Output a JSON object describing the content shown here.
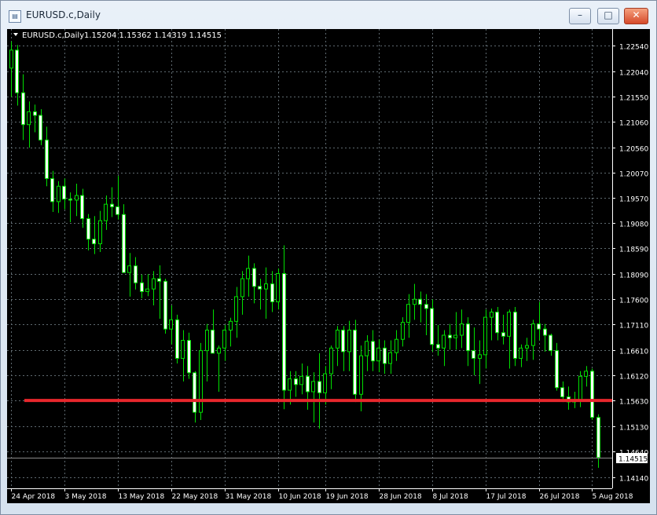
{
  "window": {
    "title": "EURUSD.c,Daily",
    "controls": {
      "minimize": "–",
      "maximize": "□",
      "close": "✕"
    }
  },
  "chart_header": {
    "symbol": "EURUSD.c,Daily",
    "ohlc": "1.15204 1.15362 1.14319 1.14515"
  },
  "chart_data": {
    "type": "candlestick",
    "symbol": "EURUSD.c",
    "timeframe": "Daily",
    "price_axis": {
      "range": [
        1.1392,
        1.2286
      ],
      "ticks": [
        1.2254,
        1.2204,
        1.2155,
        1.2106,
        1.2056,
        1.2007,
        1.1957,
        1.1908,
        1.1859,
        1.1809,
        1.176,
        1.1711,
        1.1661,
        1.1612,
        1.1563,
        1.1513,
        1.1464,
        1.1414
      ],
      "tick_labels": [
        "1.22540",
        "1.22040",
        "1.21550",
        "1.21060",
        "1.20560",
        "1.20070",
        "1.19570",
        "1.19080",
        "1.18590",
        "1.18090",
        "1.17600",
        "1.17110",
        "1.16610",
        "1.16120",
        "1.15630",
        "1.15130",
        "1.14640",
        "1.14140"
      ],
      "current_price": 1.14515,
      "current_price_label": "1.14515"
    },
    "time_axis": {
      "labels": [
        "24 Apr 2018",
        "3 May 2018",
        "13 May 2018",
        "22 May 2018",
        "31 May 2018",
        "10 Jun 2018",
        "19 Jun 2018",
        "28 Jun 2018",
        "8 Jul 2018",
        "17 Jul 2018",
        "26 Jul 2018",
        "5 Aug 2018"
      ]
    },
    "horizontal_line": {
      "price": 1.1563,
      "color": "#e8272c"
    },
    "colors": {
      "background": "#000000",
      "bull_body": "#000000",
      "bear_body": "#ffffff",
      "wick": "#00e000",
      "grid": "#5f6a70",
      "text": "#ffffff"
    },
    "grid": true,
    "candles": [
      {
        "o": 1.221,
        "h": 1.2262,
        "l": 1.2154,
        "c": 1.2245
      },
      {
        "o": 1.2245,
        "h": 1.2255,
        "l": 1.2137,
        "c": 1.2162
      },
      {
        "o": 1.2162,
        "h": 1.2198,
        "l": 1.207,
        "c": 1.21
      },
      {
        "o": 1.21,
        "h": 1.2145,
        "l": 1.2055,
        "c": 1.2125
      },
      {
        "o": 1.2125,
        "h": 1.2139,
        "l": 1.2085,
        "c": 1.2118
      },
      {
        "o": 1.2118,
        "h": 1.213,
        "l": 1.206,
        "c": 1.207
      },
      {
        "o": 1.207,
        "h": 1.2096,
        "l": 1.198,
        "c": 1.1995
      },
      {
        "o": 1.1995,
        "h": 1.201,
        "l": 1.193,
        "c": 1.195
      },
      {
        "o": 1.195,
        "h": 1.199,
        "l": 1.1928,
        "c": 1.198
      },
      {
        "o": 1.198,
        "h": 1.1995,
        "l": 1.1935,
        "c": 1.1955
      },
      {
        "o": 1.1955,
        "h": 1.1968,
        "l": 1.191,
        "c": 1.1953
      },
      {
        "o": 1.1953,
        "h": 1.1985,
        "l": 1.1922,
        "c": 1.1962
      },
      {
        "o": 1.1962,
        "h": 1.1975,
        "l": 1.1899,
        "c": 1.1917
      },
      {
        "o": 1.1917,
        "h": 1.1926,
        "l": 1.1855,
        "c": 1.1877
      },
      {
        "o": 1.1877,
        "h": 1.1922,
        "l": 1.1848,
        "c": 1.1868
      },
      {
        "o": 1.1868,
        "h": 1.1932,
        "l": 1.1852,
        "c": 1.1913
      },
      {
        "o": 1.1913,
        "h": 1.1962,
        "l": 1.1895,
        "c": 1.1945
      },
      {
        "o": 1.1945,
        "h": 1.1978,
        "l": 1.192,
        "c": 1.194
      },
      {
        "o": 1.194,
        "h": 1.2,
        "l": 1.1915,
        "c": 1.1925
      },
      {
        "o": 1.1925,
        "h": 1.1945,
        "l": 1.183,
        "c": 1.1812
      },
      {
        "o": 1.1812,
        "h": 1.185,
        "l": 1.1765,
        "c": 1.1825
      },
      {
        "o": 1.1825,
        "h": 1.1842,
        "l": 1.1779,
        "c": 1.1792
      },
      {
        "o": 1.1792,
        "h": 1.1808,
        "l": 1.1762,
        "c": 1.1775
      },
      {
        "o": 1.1775,
        "h": 1.1809,
        "l": 1.1766,
        "c": 1.178
      },
      {
        "o": 1.178,
        "h": 1.1815,
        "l": 1.1748,
        "c": 1.18
      },
      {
        "o": 1.18,
        "h": 1.1826,
        "l": 1.1722,
        "c": 1.1795
      },
      {
        "o": 1.1795,
        "h": 1.18,
        "l": 1.1693,
        "c": 1.1702
      },
      {
        "o": 1.1702,
        "h": 1.1748,
        "l": 1.1672,
        "c": 1.172
      },
      {
        "o": 1.172,
        "h": 1.173,
        "l": 1.1635,
        "c": 1.1645
      },
      {
        "o": 1.1645,
        "h": 1.17,
        "l": 1.16,
        "c": 1.168
      },
      {
        "o": 1.168,
        "h": 1.1695,
        "l": 1.1605,
        "c": 1.1617
      },
      {
        "o": 1.1617,
        "h": 1.162,
        "l": 1.152,
        "c": 1.154
      },
      {
        "o": 1.154,
        "h": 1.1675,
        "l": 1.1525,
        "c": 1.166
      },
      {
        "o": 1.166,
        "h": 1.1712,
        "l": 1.16,
        "c": 1.17
      },
      {
        "o": 1.17,
        "h": 1.174,
        "l": 1.1665,
        "c": 1.1655
      },
      {
        "o": 1.1655,
        "h": 1.167,
        "l": 1.158,
        "c": 1.1665
      },
      {
        "o": 1.1665,
        "h": 1.171,
        "l": 1.164,
        "c": 1.17
      },
      {
        "o": 1.17,
        "h": 1.1724,
        "l": 1.1668,
        "c": 1.1717
      },
      {
        "o": 1.1717,
        "h": 1.1784,
        "l": 1.1685,
        "c": 1.1765
      },
      {
        "o": 1.1765,
        "h": 1.1815,
        "l": 1.173,
        "c": 1.18
      },
      {
        "o": 1.18,
        "h": 1.1845,
        "l": 1.1765,
        "c": 1.182
      },
      {
        "o": 1.182,
        "h": 1.183,
        "l": 1.1752,
        "c": 1.1785
      },
      {
        "o": 1.1785,
        "h": 1.18,
        "l": 1.174,
        "c": 1.178
      },
      {
        "o": 1.178,
        "h": 1.1822,
        "l": 1.1722,
        "c": 1.179
      },
      {
        "o": 1.179,
        "h": 1.1815,
        "l": 1.1735,
        "c": 1.1755
      },
      {
        "o": 1.1755,
        "h": 1.182,
        "l": 1.174,
        "c": 1.181
      },
      {
        "o": 1.181,
        "h": 1.1865,
        "l": 1.1546,
        "c": 1.1583
      },
      {
        "o": 1.1583,
        "h": 1.162,
        "l": 1.1555,
        "c": 1.1605
      },
      {
        "o": 1.1605,
        "h": 1.162,
        "l": 1.157,
        "c": 1.1594
      },
      {
        "o": 1.1594,
        "h": 1.1635,
        "l": 1.1575,
        "c": 1.161
      },
      {
        "o": 1.161,
        "h": 1.163,
        "l": 1.1545,
        "c": 1.158
      },
      {
        "o": 1.158,
        "h": 1.1618,
        "l": 1.152,
        "c": 1.16
      },
      {
        "o": 1.16,
        "h": 1.1655,
        "l": 1.1508,
        "c": 1.1578
      },
      {
        "o": 1.1578,
        "h": 1.163,
        "l": 1.1555,
        "c": 1.1615
      },
      {
        "o": 1.1615,
        "h": 1.167,
        "l": 1.1585,
        "c": 1.1665
      },
      {
        "o": 1.1665,
        "h": 1.1708,
        "l": 1.163,
        "c": 1.17
      },
      {
        "o": 1.17,
        "h": 1.1708,
        "l": 1.162,
        "c": 1.1658
      },
      {
        "o": 1.1658,
        "h": 1.1718,
        "l": 1.162,
        "c": 1.17
      },
      {
        "o": 1.17,
        "h": 1.172,
        "l": 1.156,
        "c": 1.1575
      },
      {
        "o": 1.1575,
        "h": 1.167,
        "l": 1.1542,
        "c": 1.165
      },
      {
        "o": 1.165,
        "h": 1.169,
        "l": 1.162,
        "c": 1.1678
      },
      {
        "o": 1.1678,
        "h": 1.17,
        "l": 1.162,
        "c": 1.164
      },
      {
        "o": 1.164,
        "h": 1.1682,
        "l": 1.1618,
        "c": 1.1665
      },
      {
        "o": 1.1665,
        "h": 1.168,
        "l": 1.1615,
        "c": 1.1635
      },
      {
        "o": 1.1635,
        "h": 1.168,
        "l": 1.1615,
        "c": 1.1656
      },
      {
        "o": 1.1656,
        "h": 1.17,
        "l": 1.164,
        "c": 1.1682
      },
      {
        "o": 1.1682,
        "h": 1.1725,
        "l": 1.1668,
        "c": 1.1715
      },
      {
        "o": 1.1715,
        "h": 1.177,
        "l": 1.1685,
        "c": 1.175
      },
      {
        "o": 1.175,
        "h": 1.179,
        "l": 1.172,
        "c": 1.176
      },
      {
        "o": 1.176,
        "h": 1.1775,
        "l": 1.1715,
        "c": 1.175
      },
      {
        "o": 1.175,
        "h": 1.177,
        "l": 1.169,
        "c": 1.1742
      },
      {
        "o": 1.1742,
        "h": 1.176,
        "l": 1.1658,
        "c": 1.1672
      },
      {
        "o": 1.1672,
        "h": 1.171,
        "l": 1.165,
        "c": 1.1665
      },
      {
        "o": 1.1665,
        "h": 1.17,
        "l": 1.163,
        "c": 1.169
      },
      {
        "o": 1.169,
        "h": 1.1712,
        "l": 1.1662,
        "c": 1.1685
      },
      {
        "o": 1.1685,
        "h": 1.1735,
        "l": 1.1662,
        "c": 1.169
      },
      {
        "o": 1.169,
        "h": 1.174,
        "l": 1.1665,
        "c": 1.1712
      },
      {
        "o": 1.1712,
        "h": 1.1725,
        "l": 1.163,
        "c": 1.166
      },
      {
        "o": 1.166,
        "h": 1.1705,
        "l": 1.1612,
        "c": 1.1645
      },
      {
        "o": 1.1645,
        "h": 1.168,
        "l": 1.1595,
        "c": 1.1652
      },
      {
        "o": 1.1652,
        "h": 1.174,
        "l": 1.1625,
        "c": 1.1725
      },
      {
        "o": 1.1725,
        "h": 1.1742,
        "l": 1.168,
        "c": 1.1735
      },
      {
        "o": 1.1735,
        "h": 1.1745,
        "l": 1.168,
        "c": 1.1695
      },
      {
        "o": 1.1695,
        "h": 1.173,
        "l": 1.1672,
        "c": 1.1688
      },
      {
        "o": 1.1688,
        "h": 1.174,
        "l": 1.1625,
        "c": 1.1735
      },
      {
        "o": 1.1735,
        "h": 1.1745,
        "l": 1.163,
        "c": 1.1645
      },
      {
        "o": 1.1645,
        "h": 1.1672,
        "l": 1.1628,
        "c": 1.1665
      },
      {
        "o": 1.1665,
        "h": 1.1685,
        "l": 1.164,
        "c": 1.167
      },
      {
        "o": 1.167,
        "h": 1.172,
        "l": 1.1642,
        "c": 1.1712
      },
      {
        "o": 1.1712,
        "h": 1.1755,
        "l": 1.168,
        "c": 1.1702
      },
      {
        "o": 1.1702,
        "h": 1.1712,
        "l": 1.1658,
        "c": 1.169
      },
      {
        "o": 1.169,
        "h": 1.1693,
        "l": 1.165,
        "c": 1.166
      },
      {
        "o": 1.166,
        "h": 1.1675,
        "l": 1.1582,
        "c": 1.1588
      },
      {
        "o": 1.1588,
        "h": 1.16,
        "l": 1.156,
        "c": 1.157
      },
      {
        "o": 1.157,
        "h": 1.159,
        "l": 1.1545,
        "c": 1.156
      },
      {
        "o": 1.156,
        "h": 1.158,
        "l": 1.1548,
        "c": 1.1564
      },
      {
        "o": 1.1564,
        "h": 1.162,
        "l": 1.155,
        "c": 1.161
      },
      {
        "o": 1.161,
        "h": 1.163,
        "l": 1.159,
        "c": 1.162
      },
      {
        "o": 1.162,
        "h": 1.1625,
        "l": 1.1525,
        "c": 1.153
      },
      {
        "o": 1.153,
        "h": 1.1536,
        "l": 1.1432,
        "c": 1.1452
      }
    ]
  }
}
